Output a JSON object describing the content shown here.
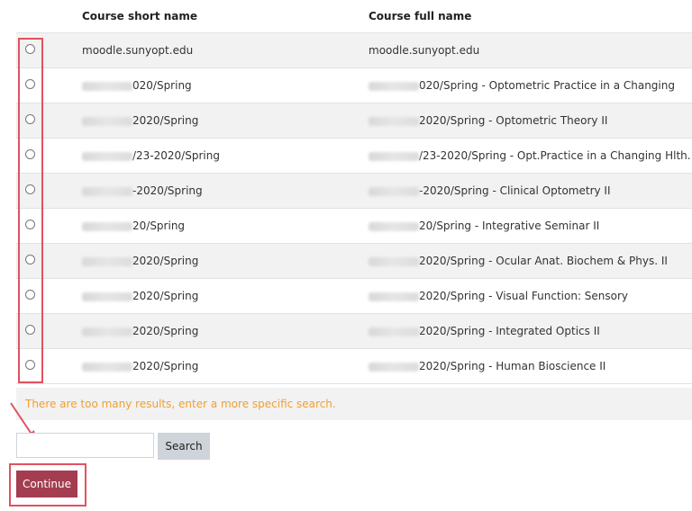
{
  "table": {
    "headers": {
      "short": "Course short name",
      "full": "Course full name"
    },
    "rows": [
      {
        "short": "moodle.sunyopt.edu",
        "full": "moodle.sunyopt.edu",
        "short_blur": false,
        "full_blur": false
      },
      {
        "short": "020/Spring",
        "full": "020/Spring - Optometric Practice in a Changing",
        "short_blur": true,
        "full_blur": true
      },
      {
        "short": "2020/Spring",
        "full": "2020/Spring - Optometric Theory II",
        "short_blur": true,
        "full_blur": true
      },
      {
        "short": "/23-2020/Spring",
        "full": "/23-2020/Spring - Opt.Practice in a Changing Hlth.",
        "short_blur": true,
        "full_blur": true
      },
      {
        "short": "-2020/Spring",
        "full": "-2020/Spring - Clinical Optometry II",
        "short_blur": true,
        "full_blur": true
      },
      {
        "short": "20/Spring",
        "full": "20/Spring - Integrative Seminar II",
        "short_blur": true,
        "full_blur": true
      },
      {
        "short": "2020/Spring",
        "full": "2020/Spring - Ocular Anat. Biochem & Phys. II",
        "short_blur": true,
        "full_blur": true
      },
      {
        "short": "2020/Spring",
        "full": "2020/Spring - Visual Function: Sensory",
        "short_blur": true,
        "full_blur": true
      },
      {
        "short": "2020/Spring",
        "full": "2020/Spring - Integrated Optics II",
        "short_blur": true,
        "full_blur": true
      },
      {
        "short": "2020/Spring",
        "full": "2020/Spring - Human Bioscience II",
        "short_blur": true,
        "full_blur": true
      }
    ]
  },
  "message": "There are too many results, enter a more specific search.",
  "search": {
    "value": "",
    "placeholder": "",
    "button_label": "Search"
  },
  "continue_label": "Continue",
  "colors": {
    "highlight": "#e05260",
    "continue_bg": "#a43d50",
    "message": "#f0a030"
  }
}
